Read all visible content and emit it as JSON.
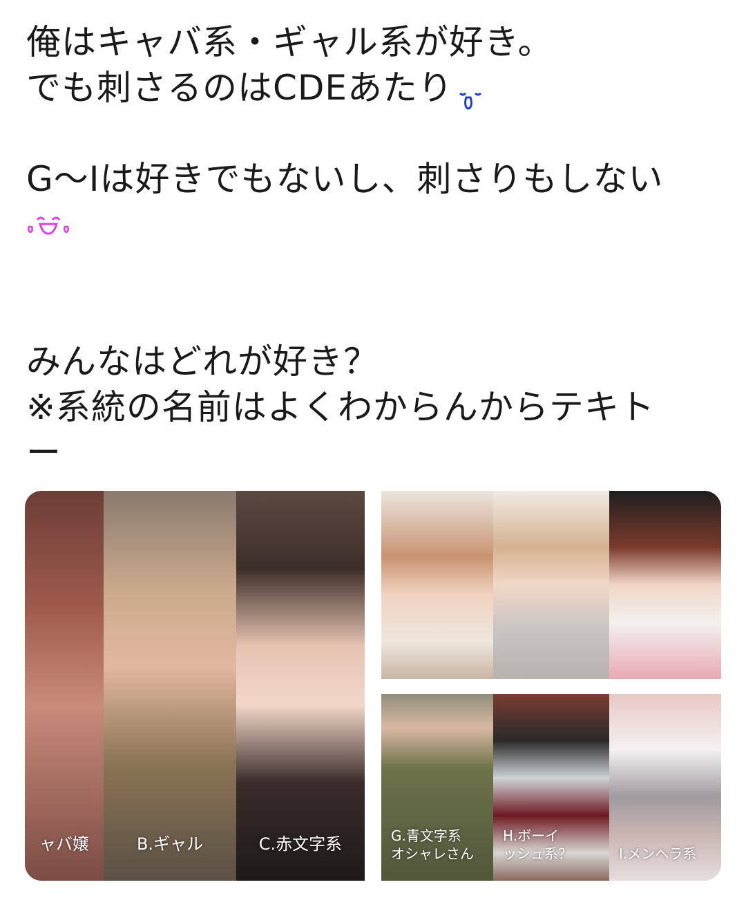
{
  "post": {
    "line1": "俺はキャバ系・ギャル系が好き。",
    "line2": "でも刺さるのはCDEあたり",
    "line3": "G〜Iは好きでもないし、刺さりもしない",
    "line4": "みんなはどれが好き？",
    "line5": "※系統の名前はよくわからんからテキト",
    "line6": "ー",
    "emoji_1": "crying-face-emoji",
    "emoji_2": "laughing-crying-face-emoji"
  },
  "images": [
    {
      "panels": [
        {
          "caption": "ャバ嬢"
        },
        {
          "caption": "B.ギャル"
        },
        {
          "caption": "C.赤文字系"
        }
      ]
    },
    {
      "panels": [
        {
          "caption": ""
        },
        {
          "caption": ""
        },
        {
          "caption": ""
        }
      ]
    },
    {
      "panels": [
        {
          "caption": "G.青文字系",
          "caption_2": "オシャレさん"
        },
        {
          "caption": "H.ボーイ",
          "caption_2": "ッシュ系？"
        },
        {
          "caption": "I.メンヘラ系"
        }
      ]
    }
  ],
  "colors": {
    "text": "#1a1a1a",
    "emoji_blue": "#1f3fd1",
    "emoji_pink": "#e23fe0"
  }
}
